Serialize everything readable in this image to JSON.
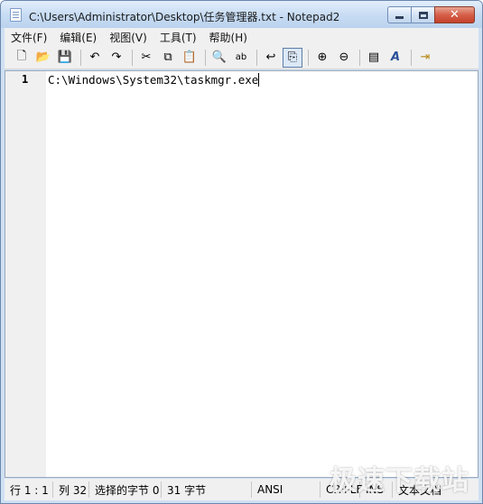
{
  "window": {
    "title": "C:\\Users\\Administrator\\Desktop\\任务管理器.txt - Notepad2",
    "close_glyph": "✕"
  },
  "menu": [
    {
      "label": "文件(F)"
    },
    {
      "label": "编辑(E)"
    },
    {
      "label": "视图(V)"
    },
    {
      "label": "工具(T)"
    },
    {
      "label": "帮助(H)"
    }
  ],
  "toolbar": {
    "icons": [
      {
        "name": "new-icon",
        "glyph": "🗋"
      },
      {
        "name": "open-icon",
        "glyph": "📂"
      },
      {
        "name": "save-icon",
        "glyph": "💾"
      },
      {
        "name": "undo-icon",
        "glyph": "↶"
      },
      {
        "name": "redo-icon",
        "glyph": "↷"
      },
      {
        "name": "cut-icon",
        "glyph": "✂"
      },
      {
        "name": "copy-icon",
        "glyph": "⧉"
      },
      {
        "name": "paste-icon",
        "glyph": "📋"
      },
      {
        "name": "find-icon",
        "glyph": "🔍"
      },
      {
        "name": "replace-icon",
        "glyph": "ab"
      },
      {
        "name": "wordwrap-icon",
        "glyph": "↩"
      },
      {
        "name": "view-whitespace-icon",
        "glyph": "⎘"
      },
      {
        "name": "zoom-in-icon",
        "glyph": "⊕"
      },
      {
        "name": "zoom-out-icon",
        "glyph": "⊖"
      },
      {
        "name": "scheme-icon",
        "glyph": "▤"
      },
      {
        "name": "font-icon",
        "glyph": "A"
      },
      {
        "name": "exit-icon",
        "glyph": "⇥"
      }
    ]
  },
  "editor": {
    "line_number": "1",
    "text": "C:\\Windows\\System32\\taskmgr.exe"
  },
  "status": {
    "position": "行 1 : 1",
    "column": "列 32",
    "selected": "选择的字节 0",
    "size": "31 字节",
    "encoding": "ANSI",
    "eol": "CR+LF",
    "ins": "INS",
    "doc_type": "文本文档"
  },
  "watermark": "极速下载站"
}
